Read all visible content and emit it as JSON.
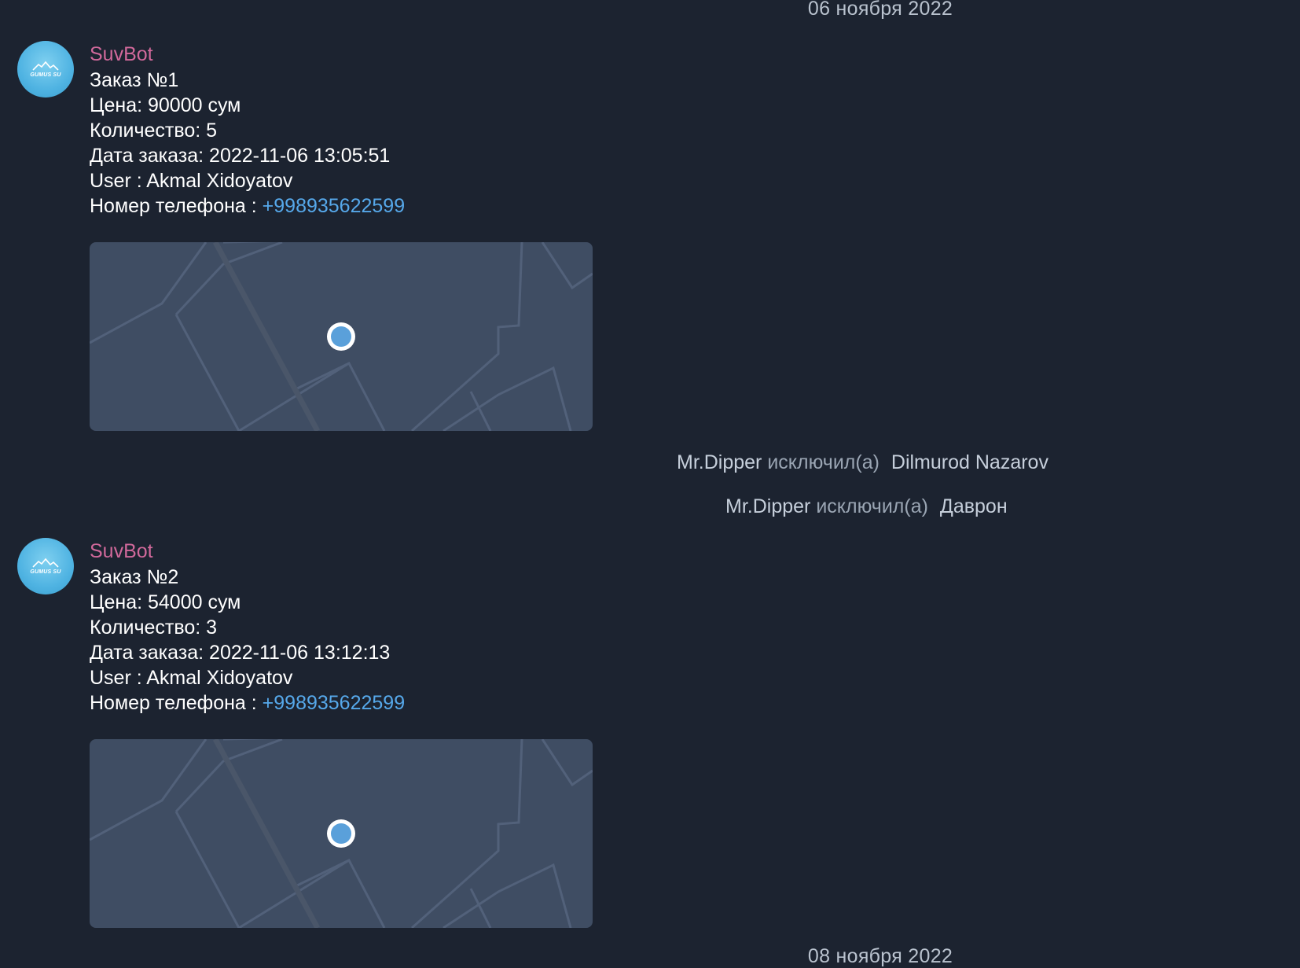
{
  "date_separators": [
    "06 ноября 2022",
    "08 ноября 2022"
  ],
  "messages": [
    {
      "sender": "SuvBot",
      "avatar_text": "GUMUS SU",
      "order": "Заказ №1",
      "price": "Цена: 90000 сум",
      "quantity": "Количество: 5",
      "date": "Дата заказа: 2022-11-06 13:05:51",
      "user": "User : Akmal Xidoyatov",
      "phone_label": "Номер телефона : ",
      "phone": "+998935622599"
    },
    {
      "sender": "SuvBot",
      "avatar_text": "GUMUS SU",
      "order": "Заказ №2",
      "price": "Цена: 54000 сум",
      "quantity": "Количество: 3",
      "date": "Дата заказа: 2022-11-06 13:12:13",
      "user": "User : Akmal Xidoyatov",
      "phone_label": "Номер телефона : ",
      "phone": "+998935622599"
    }
  ],
  "service_messages": [
    {
      "actor": "Mr.Dipper",
      "action": "исключил(а)",
      "target": "Dilmurod Nazarov"
    },
    {
      "actor": "Mr.Dipper",
      "action": "исключил(а)",
      "target": "Даврон"
    }
  ],
  "colors": {
    "background": "#1c2330",
    "sender": "#d1699b",
    "link": "#56a8ea",
    "map_bg": "#3f4d63",
    "map_pin": "#5aa0da"
  }
}
